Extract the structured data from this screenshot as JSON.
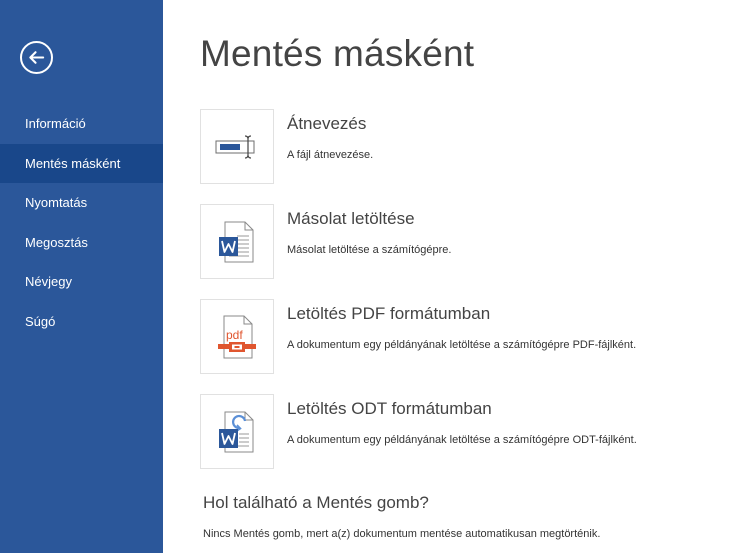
{
  "sidebar": {
    "back_icon": "back-arrow-circle-icon",
    "items": [
      {
        "label": "Információ",
        "active": false
      },
      {
        "label": "Mentés másként",
        "active": true
      },
      {
        "label": "Nyomtatás",
        "active": false
      },
      {
        "label": "Megosztás",
        "active": false
      },
      {
        "label": "Névjegy",
        "active": false
      },
      {
        "label": "Súgó",
        "active": false
      }
    ]
  },
  "main": {
    "title": "Mentés másként",
    "options": [
      {
        "icon": "rename-icon",
        "title": "Átnevezés",
        "description": "A fájl átnevezése."
      },
      {
        "icon": "word-document-icon",
        "title": "Másolat letöltése",
        "description": "Másolat letöltése a számítógépre."
      },
      {
        "icon": "pdf-document-icon",
        "title": "Letöltés PDF formátumban",
        "description": "A dokumentum egy példányának letöltése a számítógépre PDF-fájlként."
      },
      {
        "icon": "odt-document-icon",
        "title": "Letöltés ODT formátumban",
        "description": "A dokumentum egy példányának letöltése a számítógépre ODT-fájlként."
      }
    ],
    "help": {
      "heading": "Hol található a Mentés gomb?",
      "text": "Nincs Mentés gomb, mert a(z) dokumentum mentése automatikusan megtörténik."
    }
  },
  "colors": {
    "sidebar_bg": "#2b579a",
    "sidebar_active": "#19478a",
    "word_blue": "#2b579a",
    "pdf_orange": "#e0562f"
  }
}
